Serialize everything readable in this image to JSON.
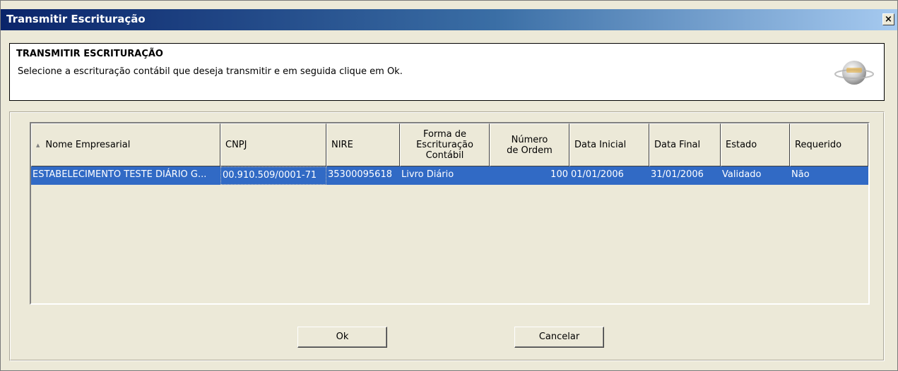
{
  "window": {
    "title": "Transmitir Escrituração",
    "close_label": "×"
  },
  "header": {
    "title": "TRANSMITIR ESCRITURAÇÃO",
    "subtitle": "Selecione a escrituração contábil que deseja transmitir e em seguida clique em Ok.",
    "logo_icon": "sped-globe-icon"
  },
  "table": {
    "columns": [
      {
        "label": "Nome Empresarial"
      },
      {
        "label": "CNPJ"
      },
      {
        "label": "NIRE"
      },
      {
        "label": "Forma de Escrituração Contábil"
      },
      {
        "label": "Número de Ordem"
      },
      {
        "label": "Data Inicial"
      },
      {
        "label": "Data Final"
      },
      {
        "label": "Estado"
      },
      {
        "label": "Requerido"
      }
    ],
    "rows": [
      {
        "nome": "ESTABELECIMENTO TESTE DIÁRIO G...",
        "cnpj": "00.910.509/0001-71",
        "nire": "35300095618",
        "forma": "Livro Diário",
        "numero": "100",
        "data_inicial": "01/01/2006",
        "data_final": "31/01/2006",
        "estado": "Validado",
        "requerido": "Não"
      }
    ],
    "selected_row_color": "#316ac5"
  },
  "buttons": {
    "ok_label": "Ok",
    "cancel_label": "Cancelar"
  }
}
